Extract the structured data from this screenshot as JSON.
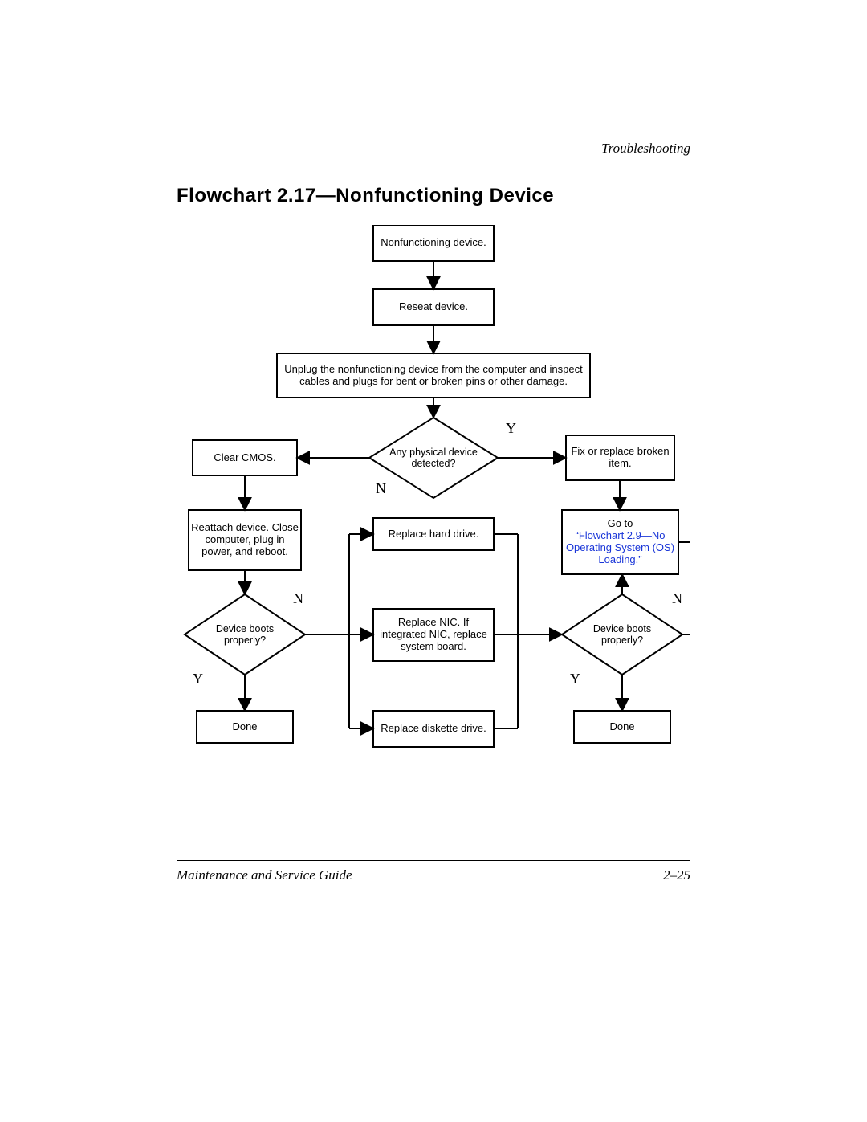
{
  "header": {
    "section": "Troubleshooting"
  },
  "title": "Flowchart 2.17—Nonfunctioning Device",
  "footer": {
    "left": "Maintenance and Service Guide",
    "right": "2–25"
  },
  "labels": {
    "yes": "Y",
    "no": "N"
  },
  "nodes": {
    "start": "Nonfunctioning device.",
    "reseat": "Reseat device.",
    "unplug": "Unplug the nonfunctioning device from the computer and inspect cables and plugs for bent or broken pins or other damage.",
    "physical": "Any physical device detected?",
    "clear_cmos": "Clear CMOS.",
    "fix_replace": "Fix or replace broken item.",
    "goto_prefix": "Go to ",
    "goto_link": "“Flowchart 2.9—No Operat­ing System (OS) Loading.”",
    "reattach": "Reattach device. Close computer, plug in power, and reboot.",
    "boots_left": "Device boots properly?",
    "boots_right": "Device boots properly?",
    "done_left": "Done",
    "done_right": "Done",
    "replace_hd": "Replace hard drive.",
    "replace_nic": "Replace NIC. If integrated NIC, replace system board.",
    "replace_diskette": "Replace diskette drive."
  }
}
